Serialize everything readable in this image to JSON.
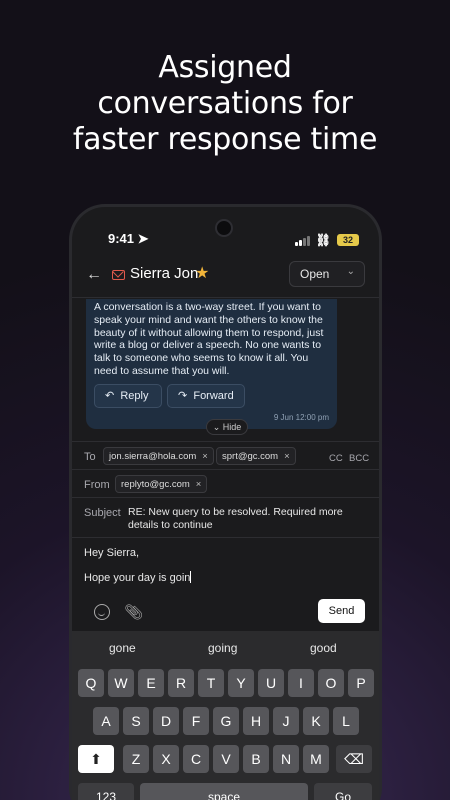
{
  "headline": {
    "line1": "Assigned",
    "line2": "conversations for",
    "line3": "faster response time"
  },
  "status_bar": {
    "time": "9:41",
    "battery": "32"
  },
  "header": {
    "contact_name": "Sierra Jon",
    "status_value": "Open"
  },
  "message": {
    "text": "A conversation is a two-way street. If you want to speak your mind and want the others to know the beauty of it without allowing them to respond, just write a blog or deliver a speech. No one wants to talk to someone who seems to know it all. You need to assume that you will.",
    "reply_label": "Reply",
    "forward_label": "Forward",
    "timestamp": "9 Jun 12:00 pm",
    "hide_label": "Hide"
  },
  "compose": {
    "to_label": "To",
    "to_recipients": [
      "jon.sierra@hola.com",
      "sprt@gc.com"
    ],
    "cc_label": "CC",
    "bcc_label": "BCC",
    "from_label": "From",
    "from_address": "replyto@gc.com",
    "subject_label": "Subject",
    "subject_value": "RE: New query to be resolved. Required more details to continue",
    "body_line1": "Hey Sierra,",
    "body_line2": "Hope your day is goin",
    "send_label": "Send"
  },
  "keyboard": {
    "suggestions": [
      "gone",
      "going",
      "good"
    ],
    "row1": [
      "Q",
      "W",
      "E",
      "R",
      "T",
      "Y",
      "U",
      "I",
      "O",
      "P"
    ],
    "row2": [
      "A",
      "S",
      "D",
      "F",
      "G",
      "H",
      "J",
      "K",
      "L"
    ],
    "row3": [
      "Z",
      "X",
      "C",
      "V",
      "B",
      "N",
      "M"
    ],
    "shift": "⬆",
    "backspace": "⌫",
    "numbers_label": "123",
    "space_label": "space",
    "go_label": "Go"
  },
  "icons": {
    "back": "arrow-left-icon",
    "mail": "mail-icon",
    "star": "star-icon",
    "reply": "reply-icon",
    "forward": "forward-icon",
    "emoji": "emoji-icon",
    "attach": "paperclip-icon"
  },
  "colors": {
    "star": "#f2b53a",
    "mail_icon": "#e05a4d",
    "bubble": "#1f2e40",
    "battery": "#e5c94a"
  }
}
